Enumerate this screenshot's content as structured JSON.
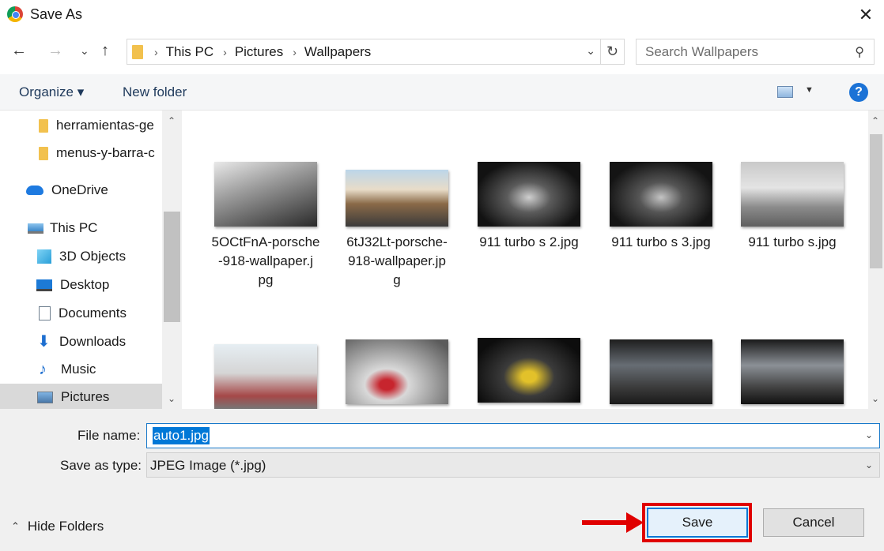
{
  "window": {
    "title": "Save As"
  },
  "nav": {
    "breadcrumbs": [
      "This PC",
      "Pictures",
      "Wallpapers"
    ],
    "search_placeholder": "Search Wallpapers"
  },
  "toolbar": {
    "organize": "Organize",
    "new_folder": "New folder",
    "help": "?"
  },
  "sidebar": {
    "items": [
      {
        "label": "herramientas-ge",
        "icon": "folder-icon"
      },
      {
        "label": "menus-y-barra-c",
        "icon": "folder-icon"
      },
      {
        "label": "OneDrive",
        "icon": "cloud-icon"
      },
      {
        "label": "This PC",
        "icon": "computer-icon"
      },
      {
        "label": "3D Objects",
        "icon": "3d-objects-icon"
      },
      {
        "label": "Desktop",
        "icon": "desktop-icon"
      },
      {
        "label": "Documents",
        "icon": "documents-icon"
      },
      {
        "label": "Downloads",
        "icon": "download-icon"
      },
      {
        "label": "Music",
        "icon": "music-icon"
      },
      {
        "label": "Pictures",
        "icon": "pictures-icon",
        "selected": true
      }
    ]
  },
  "files": [
    {
      "name": "5OCtFnA-porsche-918-wallpaper.jpg",
      "lines": [
        "5OCtFnA-porsche",
        "-918-wallpaper.j",
        "pg"
      ]
    },
    {
      "name": "6tJ32Lt-porsche-918-wallpaper.jpg",
      "lines": [
        "6tJ32Lt-porsche-",
        "918-wallpaper.jp",
        "g"
      ]
    },
    {
      "name": "911 turbo s 2.jpg",
      "lines": [
        "911 turbo s 2.jpg"
      ]
    },
    {
      "name": "911 turbo s 3.jpg",
      "lines": [
        "911 turbo s 3.jpg"
      ]
    },
    {
      "name": "911 turbo s.jpg",
      "lines": [
        "911 turbo s.jpg"
      ]
    }
  ],
  "form": {
    "file_name_label": "File name:",
    "file_name_value": "auto1.jpg",
    "save_type_label": "Save as type:",
    "save_type_value": "JPEG Image (*.jpg)"
  },
  "footer": {
    "hide_folders": "Hide Folders",
    "save": "Save",
    "cancel": "Cancel"
  },
  "colors": {
    "accent": "#0078d7",
    "highlight": "#e00000"
  }
}
